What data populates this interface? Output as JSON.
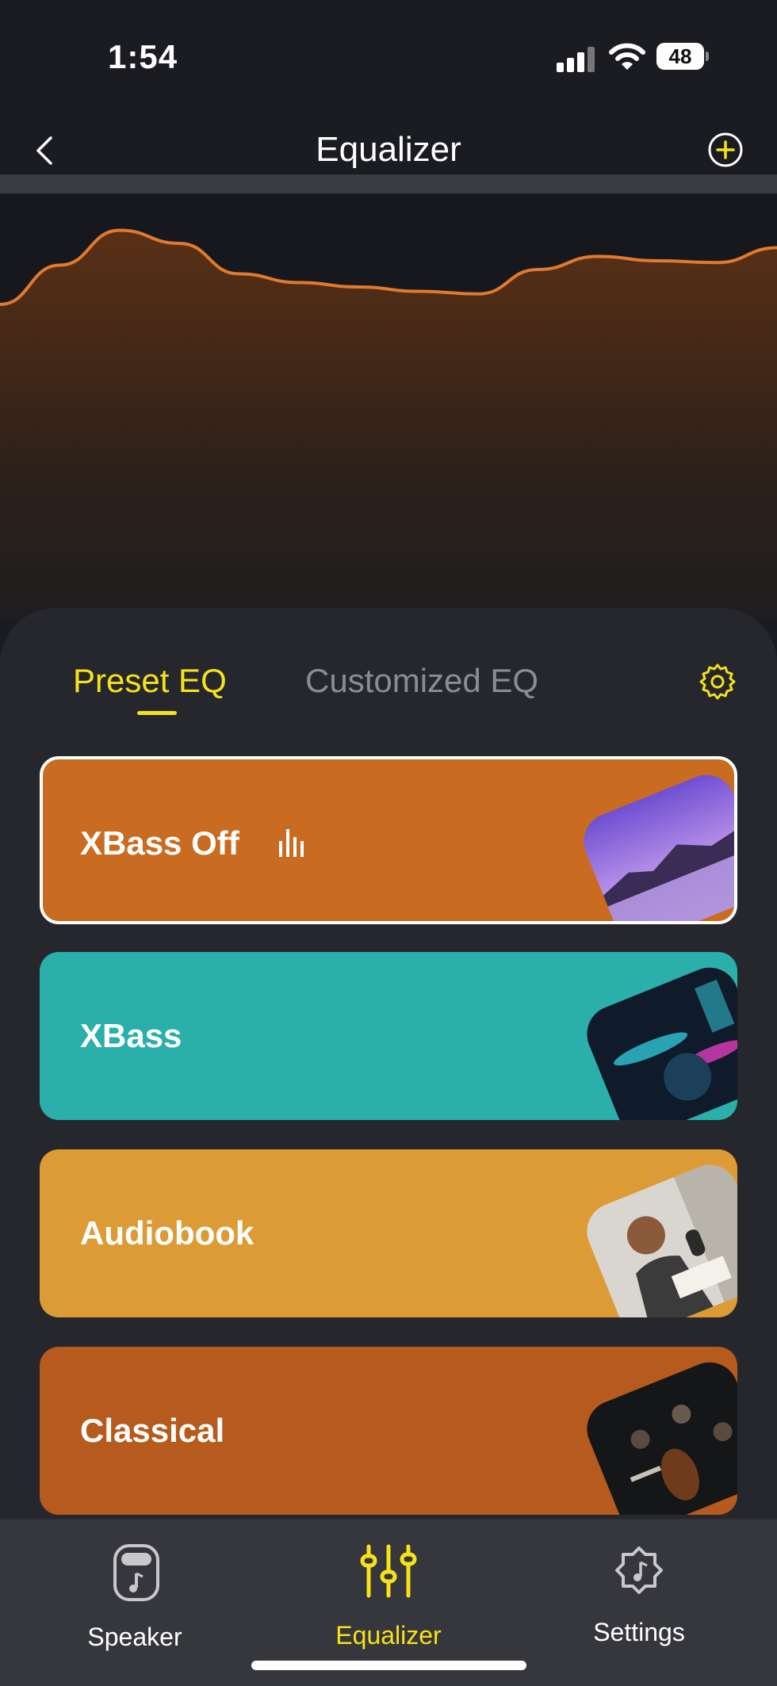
{
  "status_bar": {
    "time": "1:54",
    "battery": "48"
  },
  "header": {
    "title": "Equalizer",
    "back_icon": "chevron-left-icon",
    "add_icon": "plus-circle-icon"
  },
  "colors": {
    "accent": "#f6e21a",
    "curve": "#e07a2e",
    "panel": "#25272d"
  },
  "eq_curve": [
    0.0,
    0.45,
    0.85,
    0.7,
    0.35,
    0.25,
    0.2,
    0.15,
    0.12,
    0.4,
    0.55,
    0.5,
    0.48,
    0.65
  ],
  "tabs": [
    {
      "label": "Preset EQ",
      "active": true
    },
    {
      "label": "Customized EQ",
      "active": false
    }
  ],
  "settings_icon": "gear-icon",
  "presets": [
    {
      "label": "XBass Off",
      "color": "#c96b20",
      "selected": true,
      "playing_icon": "equalizer-bars-icon",
      "thumb_icon": "lake-mountain-image"
    },
    {
      "label": "XBass",
      "color": "#2aafaa",
      "selected": false,
      "thumb_icon": "drummer-image"
    },
    {
      "label": "Audiobook",
      "color": "#dc9b35",
      "selected": false,
      "thumb_icon": "microphone-reader-image"
    },
    {
      "label": "Classical",
      "color": "#b65a1d",
      "selected": false,
      "thumb_icon": "orchestra-image"
    }
  ],
  "bottom_nav": [
    {
      "label": "Speaker",
      "icon": "speaker-icon",
      "active": false
    },
    {
      "label": "Equalizer",
      "icon": "sliders-icon",
      "active": true
    },
    {
      "label": "Settings",
      "icon": "settings-icon",
      "active": false
    }
  ]
}
